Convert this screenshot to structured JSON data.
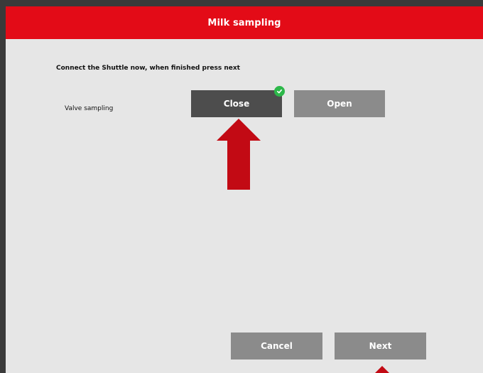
{
  "dialog": {
    "title": "Milk sampling",
    "instruction": "Connect the Shuttle now, when finished press next",
    "valve_row": {
      "label": "Valve sampling",
      "options": [
        "Close",
        "Open"
      ],
      "selected": "Close"
    },
    "footer": {
      "cancel_label": "Cancel",
      "next_label": "Next"
    }
  },
  "colors": {
    "title_bar": "#e30b17",
    "panel": "#e6e6e6",
    "button_selected": "#4d4d4d",
    "button_default": "#8b8b8b",
    "check_badge": "#2db84a",
    "annotation_arrow": "#c20a14"
  },
  "icons": {
    "selected_check": "check-circle-icon",
    "annotation": "red-arrow-up-annotation"
  }
}
